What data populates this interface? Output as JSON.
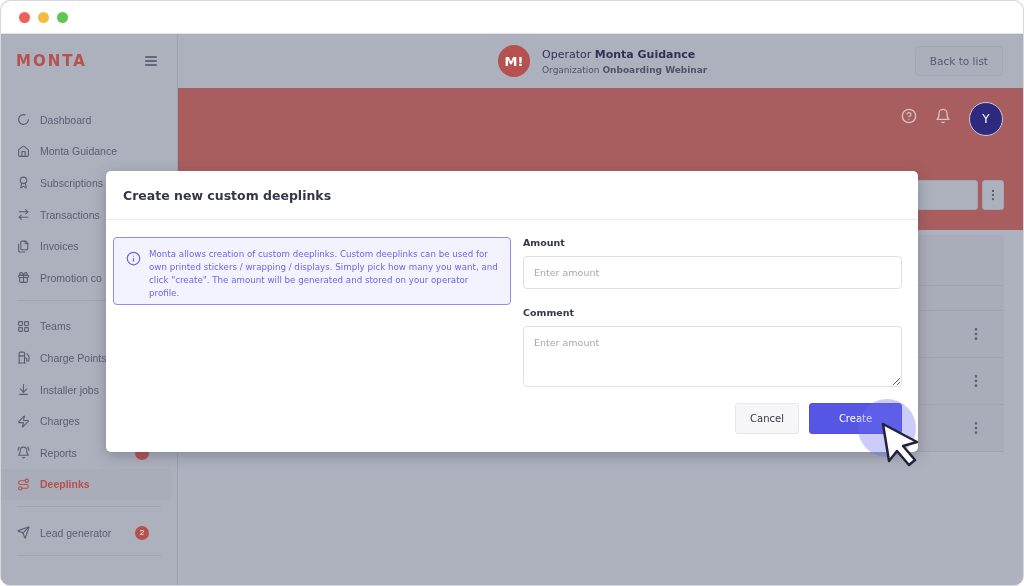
{
  "brand": {
    "logo": "MONTA"
  },
  "sidebar": {
    "groups": [
      {
        "items": [
          {
            "label": "Dashboard",
            "selected": false
          },
          {
            "label": "Monta Guidance",
            "selected": false
          },
          {
            "label": "Subscriptions",
            "selected": false
          },
          {
            "label": "Transactions",
            "selected": false
          },
          {
            "label": "Invoices",
            "selected": false
          },
          {
            "label": "Promotion co",
            "selected": false
          }
        ]
      },
      {
        "items": [
          {
            "label": "Teams",
            "selected": false
          },
          {
            "label": "Charge Points",
            "selected": false
          },
          {
            "label": "Installer jobs",
            "selected": false
          },
          {
            "label": "Charges",
            "selected": false
          },
          {
            "label": "Reports",
            "selected": false,
            "notification": true
          },
          {
            "label": "Deeplinks",
            "selected": true
          }
        ]
      },
      {
        "items": [
          {
            "label": "Lead generator",
            "selected": false,
            "badge": "2"
          }
        ]
      }
    ]
  },
  "header": {
    "avatar": "M!",
    "operator_prefix": "Operator",
    "operator": "Monta Guidance",
    "organization_prefix": "Organization",
    "organization": "Onboarding Webinar",
    "back_button": "Back to list",
    "user_avatar": "Y"
  },
  "dialog": {
    "title": "Create new custom deeplinks",
    "info": "Monta allows creation of custom deeplinks. Custom deeplinks can be used for own printed stickers / wrapping / displays. Simply pick how many you want, and click \"create\". The amount will be generated and stored on your operator profile.",
    "fields": [
      {
        "label": "Amount",
        "placeholder": "Enter amount",
        "kind": "input"
      },
      {
        "label": "Comment",
        "placeholder": "Enter amount",
        "kind": "textarea"
      }
    ],
    "cancel": "Cancel",
    "create": "Create"
  }
}
